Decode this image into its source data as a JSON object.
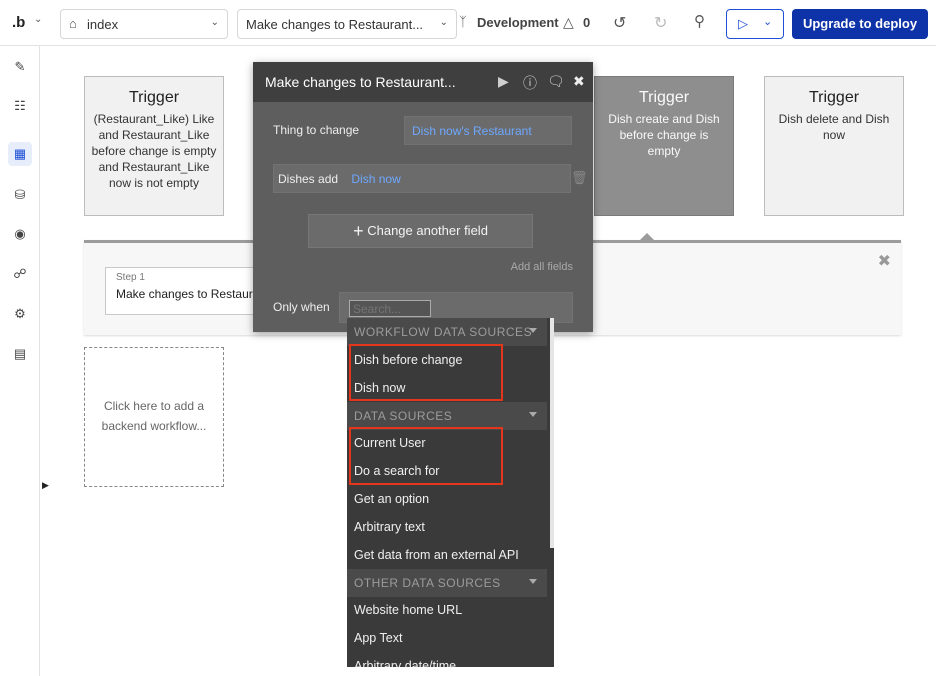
{
  "topbar": {
    "logo": ".b",
    "page_select": "index",
    "workflow_select": "Make changes to Restaurant...",
    "branch": "Development",
    "issues_count": "0",
    "deploy_label": "Upgrade to deploy"
  },
  "sidebar": {
    "items": [
      {
        "name": "design"
      },
      {
        "name": "workflow"
      },
      {
        "name": "backend-workflows"
      },
      {
        "name": "data"
      },
      {
        "name": "styles"
      },
      {
        "name": "plugins"
      },
      {
        "name": "settings"
      },
      {
        "name": "logs"
      }
    ]
  },
  "triggers": [
    {
      "title": "Trigger",
      "desc": "(Restaurant_Like) Like and Restaurant_Like before change is empty and Restaurant_Like now is not empty"
    },
    {
      "title": "Trigger",
      "desc": "Dish create and Dish before change is empty"
    },
    {
      "title": "Trigger",
      "desc": "Dish delete and Dish now"
    }
  ],
  "step": {
    "label": "Step 1",
    "name": "Make changes to Restaurant..."
  },
  "add_backend": "Click here to add a backend workflow...",
  "modal": {
    "title": "Make changes to Restaurant...",
    "thing_label": "Thing to change",
    "thing_value": "Dish now's Restaurant",
    "field_label": "Dishes add",
    "field_value": "Dish now",
    "change_another": "Change another field",
    "add_all": "Add all fields",
    "only_when": "Only when",
    "search_placeholder": "Search..."
  },
  "dropdown": {
    "sections": [
      {
        "header": "WORKFLOW DATA SOURCES",
        "items": [
          "Dish before change",
          "Dish now"
        ]
      },
      {
        "header": "DATA SOURCES",
        "items": [
          "Current User",
          "Do a search for",
          "Get an option",
          "Arbitrary text",
          "Get data from an external API"
        ]
      },
      {
        "header": "OTHER DATA SOURCES",
        "items": [
          "Website home URL",
          "App Text",
          "Arbitrary date/time"
        ]
      }
    ]
  },
  "colors": {
    "accent": "#1e4fd6",
    "deploy_bg": "#0e32a8",
    "highlight": "#e4361b",
    "link": "#6ea8ff"
  }
}
